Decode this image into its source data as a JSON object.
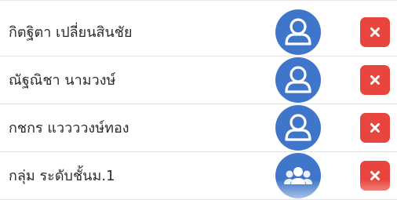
{
  "members": [
    {
      "name": "กิตฐิตา เปลี่ยนสินชัย",
      "avatar_icon": "person-icon",
      "remove_icon": "close-icon"
    },
    {
      "name": "ณัฐณิชา นามวงษ์",
      "avatar_icon": "person-icon",
      "remove_icon": "close-icon"
    },
    {
      "name": "กชกร แววววงษ์ทอง",
      "avatar_icon": "person-icon",
      "remove_icon": "close-icon"
    },
    {
      "name": "กลุ่ม ระดับชั้นม.1",
      "avatar_icon": "group-icon",
      "remove_icon": "close-icon"
    }
  ],
  "colors": {
    "avatar_bg": "#3f76c9",
    "remove_bg": "#e8453e",
    "text": "#2b2b2b",
    "divider": "#e3e3e3"
  }
}
